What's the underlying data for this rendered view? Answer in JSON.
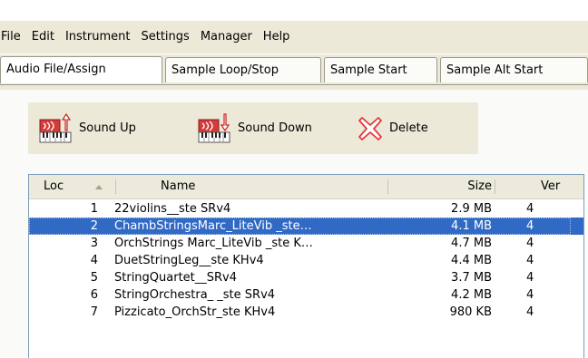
{
  "menu": [
    "File",
    "Edit",
    "Instrument",
    "Settings",
    "Manager",
    "Help"
  ],
  "tabs": [
    "Audio File/Assign",
    "Sample Loop/Stop",
    "Sample Start",
    "Sample Alt Start"
  ],
  "toolbar": {
    "sound_up": "Sound Up",
    "sound_down": "Sound Down",
    "delete": "Delete"
  },
  "list": {
    "columns": {
      "loc": "Loc",
      "name": "Name",
      "size": "Size",
      "ver": "Ver"
    },
    "sort_indicator": "ascending",
    "selected_index": 1,
    "rows": [
      {
        "loc": "1",
        "name": "22violins__ste SRv4",
        "size": "2.9 MB",
        "ver": "4"
      },
      {
        "loc": "2",
        "name": "ChambStringsMarc_LiteVib _ste…",
        "size": "4.1 MB",
        "ver": "4"
      },
      {
        "loc": "3",
        "name": "OrchStrings Marc_LiteVib _ste K…",
        "size": "4.7 MB",
        "ver": "4"
      },
      {
        "loc": "4",
        "name": "DuetStringLeg__ste KHv4",
        "size": "4.4 MB",
        "ver": "4"
      },
      {
        "loc": "5",
        "name": "StringQuartet__SRv4",
        "size": "3.7 MB",
        "ver": "4"
      },
      {
        "loc": "6",
        "name": "StringOrchestra_ _ste SRv4",
        "size": "4.2 MB",
        "ver": "4"
      },
      {
        "loc": "7",
        "name": "Pizzicato_OrchStr_ste KHv4",
        "size": "980 KB",
        "ver": "4"
      }
    ]
  },
  "colors": {
    "chrome": "#ece9d8",
    "selection": "#316ac5",
    "delete_icon": "#e8383c"
  },
  "icons": {
    "sound_up": "keyboard-arrow-up-icon",
    "sound_down": "keyboard-arrow-down-icon",
    "delete": "x-icon",
    "sort": "sort-ascending-icon"
  }
}
